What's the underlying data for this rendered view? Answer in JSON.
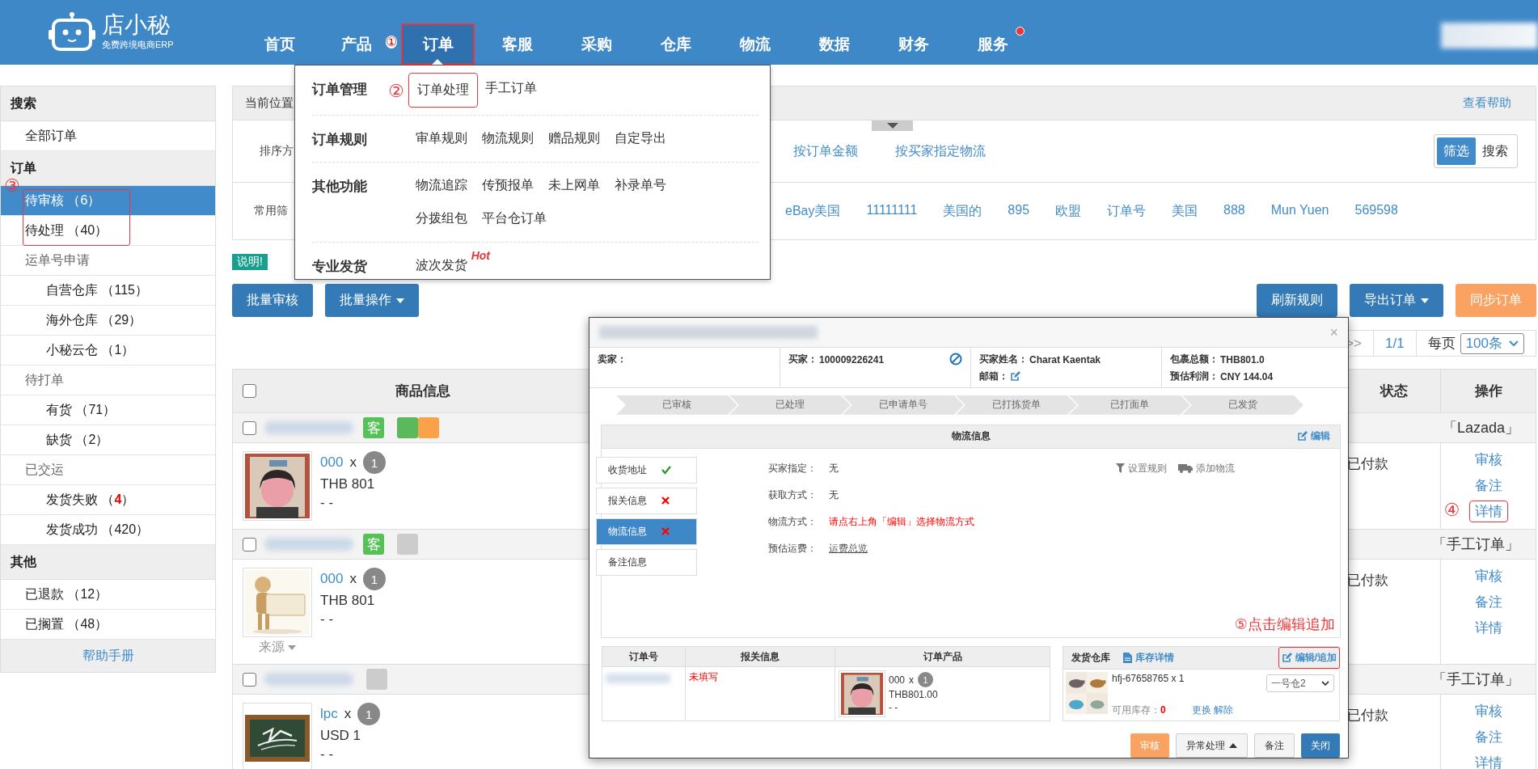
{
  "header": {
    "logo": {
      "name": "店小秘",
      "tagline": "免费跨境电商ERP"
    },
    "nav": [
      {
        "label": "首页",
        "selected": false,
        "highlight": false,
        "notification": false
      },
      {
        "label": "产品",
        "selected": false,
        "highlight": false,
        "notification": false,
        "marker": "①"
      },
      {
        "label": "订单",
        "selected": true,
        "highlight": true,
        "notification": false
      },
      {
        "label": "客服",
        "selected": false,
        "highlight": false,
        "notification": false
      },
      {
        "label": "采购",
        "selected": false,
        "highlight": false,
        "notification": false
      },
      {
        "label": "仓库",
        "selected": false,
        "highlight": false,
        "notification": false
      },
      {
        "label": "物流",
        "selected": false,
        "highlight": false,
        "notification": false
      },
      {
        "label": "数据",
        "selected": false,
        "highlight": false,
        "notification": false
      },
      {
        "label": "财务",
        "selected": false,
        "highlight": false,
        "notification": false
      },
      {
        "label": "服务",
        "selected": false,
        "highlight": false,
        "notification": true
      }
    ],
    "user": {
      "redacted": true
    }
  },
  "order_menu": {
    "groups": [
      {
        "label": "订单管理",
        "items": [
          {
            "label": "订单处理",
            "highlight": true,
            "marker": "②"
          },
          {
            "label": "手工订单",
            "highlight": false
          }
        ]
      },
      {
        "label": "订单规则",
        "items": [
          {
            "label": "审单规则",
            "highlight": false
          },
          {
            "label": "物流规则",
            "highlight": false
          },
          {
            "label": "赠品规则",
            "highlight": false
          },
          {
            "label": "自定导出",
            "highlight": false
          }
        ]
      },
      {
        "label": "其他功能",
        "items": [
          {
            "label": "物流追踪",
            "highlight": false
          },
          {
            "label": "传预报单",
            "highlight": false
          },
          {
            "label": "未上网单",
            "highlight": false
          },
          {
            "label": "补录单号",
            "highlight": false
          },
          {
            "label": "分拨组包",
            "highlight": false
          },
          {
            "label": "平台仓订单",
            "highlight": false
          }
        ]
      },
      {
        "label": "专业发货",
        "items": [
          {
            "label": "波次发货",
            "highlight": false,
            "badge": "Hot"
          }
        ]
      }
    ]
  },
  "sidebar": {
    "marker": "③",
    "items": [
      {
        "kind": "header",
        "label": "搜索"
      },
      {
        "kind": "item",
        "label": "全部订单",
        "selected": false,
        "highlight": false
      },
      {
        "kind": "header",
        "label": "订单"
      },
      {
        "kind": "item",
        "label": "待审核 （6）",
        "selected": true,
        "highlight": true
      },
      {
        "kind": "item",
        "label": "待处理 （40）",
        "selected": false,
        "highlight": true
      },
      {
        "kind": "group",
        "label": "运单号申请",
        "selected": false,
        "highlight": false
      },
      {
        "kind": "subitem",
        "label": "自营仓库 （115）",
        "selected": false,
        "highlight": false
      },
      {
        "kind": "subitem",
        "label": "海外仓库 （29）",
        "selected": false,
        "highlight": false
      },
      {
        "kind": "subitem",
        "label": "小秘云仓 （1）",
        "selected": false,
        "highlight": false
      },
      {
        "kind": "group",
        "label": "待打单",
        "selected": false,
        "highlight": false
      },
      {
        "kind": "subitem",
        "label": "有货 （71）",
        "selected": false,
        "highlight": false
      },
      {
        "kind": "subitem",
        "label": "缺货 （2）",
        "selected": false,
        "highlight": false
      },
      {
        "kind": "group",
        "label": "已交运",
        "selected": false,
        "highlight": false
      },
      {
        "kind": "subitem",
        "label": "发货失败 （**4**）",
        "selected": false,
        "highlight": false
      },
      {
        "kind": "subitem",
        "label": "发货成功 （420）",
        "selected": false,
        "highlight": false
      },
      {
        "kind": "header",
        "label": "其他"
      },
      {
        "kind": "item",
        "label": "已退款 （12）",
        "selected": false,
        "highlight": false
      },
      {
        "kind": "item",
        "label": "已搁置 （48）",
        "selected": false,
        "highlight": false
      }
    ],
    "footer": "帮助手册"
  },
  "breadcrumb": {
    "label": "当前位置",
    "help": "查看帮助"
  },
  "filters": {
    "sort": {
      "label": "排序方",
      "options": [
        "按订单金额",
        "按买家指定物流"
      ]
    },
    "mode_toggle": [
      {
        "label": "筛选",
        "selected": true
      },
      {
        "label": "搜索",
        "selected": false
      }
    ],
    "common": {
      "label": "常用筛",
      "options": [
        "eBay美国",
        "11111111",
        "美国的",
        "895",
        "欧盟",
        "订单号",
        "美国",
        "888",
        "Mun Yuen",
        "569598"
      ]
    }
  },
  "notice": "说明!",
  "toolbar": {
    "left": [
      {
        "label": "批量审核",
        "kind": "primary",
        "caret": false
      },
      {
        "label": "批量操作",
        "kind": "primary",
        "caret": true
      }
    ],
    "right": [
      {
        "label": "刷新规则",
        "kind": "primary",
        "caret": false
      },
      {
        "label": "导出订单",
        "kind": "primary",
        "caret": true
      },
      {
        "label": "同步订单",
        "kind": "warning",
        "caret": false
      }
    ]
  },
  "pagination": {
    "next": ">>",
    "page": "1/1",
    "per_page_label": "每页",
    "per_page": "100条"
  },
  "table": {
    "columns": [
      "商品信息",
      "状态",
      "操作"
    ],
    "checked": false,
    "orders": [
      {
        "checked": false,
        "id_redacted": true,
        "tags": [
          "客"
        ],
        "flags": [
          {
            "color": "#5cb85c"
          },
          {
            "color": "#f9a24a"
          }
        ],
        "source": "「Lazada」",
        "item": {
          "sku": "000",
          "times": "x",
          "qty": "1",
          "price": "THB 801",
          "note": "- -"
        },
        "status": "已付款",
        "actions": [
          {
            "label": "审核",
            "highlight": false
          },
          {
            "label": "备注",
            "highlight": false
          },
          {
            "label": "详情",
            "highlight": true,
            "marker": "④"
          }
        ]
      },
      {
        "checked": false,
        "id_redacted": true,
        "tags": [
          "客"
        ],
        "flags": [
          {
            "color": "#cccccc"
          }
        ],
        "source": "「手工订单」",
        "item": {
          "sku": "000",
          "times": "x",
          "qty": "1",
          "price": "THB 801",
          "note": "- -"
        },
        "origin": "来源",
        "status": "已付款",
        "actions": [
          {
            "label": "审核",
            "highlight": false
          },
          {
            "label": "备注",
            "highlight": false
          },
          {
            "label": "详情",
            "highlight": false
          }
        ]
      },
      {
        "checked": false,
        "id_redacted": true,
        "flags": [
          {
            "color": "#cccccc"
          }
        ],
        "source": "「手工订单」",
        "item": {
          "sku": "lpc",
          "times": "x",
          "qty": "1",
          "price": "USD 1",
          "note": "- -"
        },
        "status": "已付款",
        "actions": [
          {
            "label": "审核",
            "highlight": false
          },
          {
            "label": "备注",
            "highlight": false
          },
          {
            "label": "详情",
            "highlight": false
          }
        ]
      }
    ]
  },
  "order_dialog": {
    "title_redacted": true,
    "close": "×",
    "info": [
      {
        "lines": [
          {
            "label": "卖家："
          }
        ]
      },
      {
        "lines": [
          {
            "label": "买家：",
            "value": "100009226241"
          }
        ],
        "kind": "blockable"
      },
      {
        "lines": [
          {
            "label": "买家姓名：",
            "value": "Charat Kaentak"
          },
          {
            "label": "邮箱：",
            "kind": "editable"
          }
        ]
      },
      {
        "lines": [
          {
            "label": "包裹总额：",
            "value": "THB801.0"
          },
          {
            "label": "预估利润：",
            "value": "CNY 144.04"
          }
        ]
      }
    ],
    "steps": [
      "已审核",
      "已处理",
      "已申请单号",
      "已打拣货单",
      "已打面单",
      "已发货"
    ],
    "panel": {
      "title": "物流信息",
      "edit": "编辑",
      "tabs": [
        {
          "label": "收货地址",
          "kind": "complete",
          "selected": false
        },
        {
          "label": "报关信息",
          "kind": "incomplete",
          "selected": false
        },
        {
          "label": "物流信息",
          "kind": "incomplete",
          "selected": true
        },
        {
          "label": "备注信息",
          "kind": "plain",
          "selected": false
        }
      ],
      "fields": [
        {
          "label": "买家指定：",
          "value": "无",
          "kind": "plain"
        },
        {
          "label": "获取方式：",
          "value": "无",
          "kind": "plain"
        },
        {
          "label": "物流方式：",
          "value": "请点右上角「编辑」选择物流方式",
          "kind": "warning"
        },
        {
          "label": "预估运费：",
          "value": "运费总览",
          "kind": "link"
        }
      ],
      "tools": [
        {
          "label": "设置规则",
          "kind": "rule"
        },
        {
          "label": "添加物流",
          "kind": "shipping"
        }
      ],
      "note": "⑤点击编辑追加"
    },
    "order_table": {
      "columns": [
        "订单号",
        "报关信息",
        "订单产品"
      ],
      "row": {
        "id_redacted": true,
        "customs": "未填写",
        "product": {
          "sku": "000",
          "times": "x",
          "qty": "1",
          "price": "THB801.00",
          "note": "- -"
        }
      }
    },
    "warehouse": {
      "label": "发货仓库",
      "detail_link": "库存详情",
      "edit": {
        "label": "编辑/追加",
        "highlight": true
      },
      "item": {
        "sku": "hfj-67658765 x 1",
        "stock_label": "可用库存：",
        "stock": "0",
        "actions": [
          "更换",
          "解除"
        ],
        "warehouse": "一号仓2"
      }
    },
    "buttons": [
      {
        "label": "审核",
        "kind": "warning",
        "caret": false
      },
      {
        "label": "异常处理",
        "kind": "default",
        "caret": true
      },
      {
        "label": "备注",
        "kind": "default",
        "caret": false
      },
      {
        "label": "关闭",
        "kind": "primary",
        "caret": false
      }
    ]
  }
}
